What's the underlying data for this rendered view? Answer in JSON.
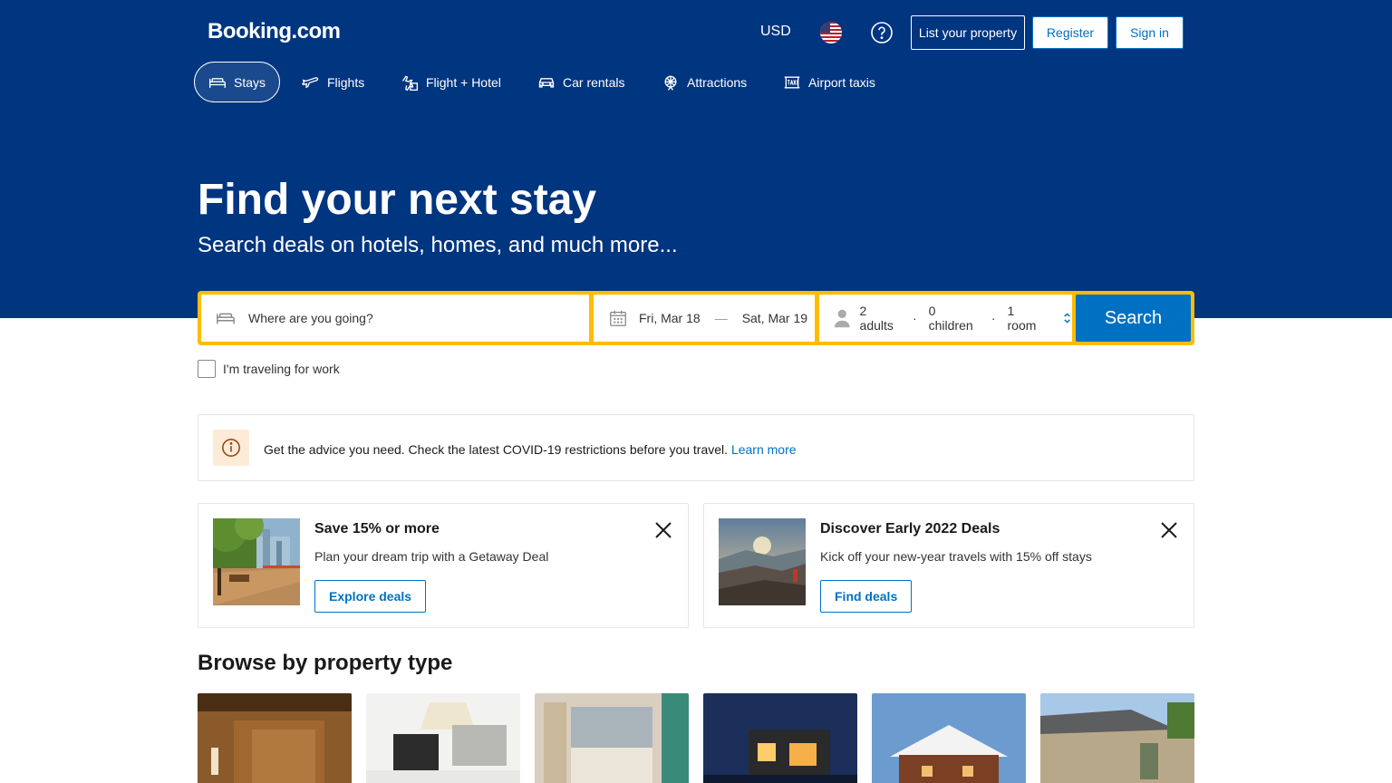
{
  "header": {
    "logo": "Booking.com",
    "currency": "USD",
    "flag_icon": "us-flag-icon",
    "help_icon": "question-circle-icon",
    "list_property": "List your property",
    "register": "Register",
    "sign_in": "Sign in"
  },
  "nav": {
    "items": [
      {
        "label": "Stays",
        "icon": "bed-icon",
        "active": true
      },
      {
        "label": "Flights",
        "icon": "plane-icon",
        "active": false
      },
      {
        "label": "Flight + Hotel",
        "icon": "plane-hotel-icon",
        "active": false
      },
      {
        "label": "Car rentals",
        "icon": "car-icon",
        "active": false
      },
      {
        "label": "Attractions",
        "icon": "ferris-wheel-icon",
        "active": false
      },
      {
        "label": "Airport taxis",
        "icon": "taxi-icon",
        "active": false
      }
    ]
  },
  "hero": {
    "title": "Find your next stay",
    "subtitle": "Search deals on hotels, homes, and much more..."
  },
  "search": {
    "destination_placeholder": "Where are you going?",
    "checkin": "Fri, Mar 18",
    "checkout": "Sat, Mar 19",
    "adults": "2 adults",
    "children": "0 children",
    "rooms": "1 room",
    "button": "Search"
  },
  "work_travel": {
    "label": "I'm traveling for work",
    "checked": false
  },
  "notice": {
    "text": "Get the advice you need. Check the latest COVID-19 restrictions before you travel.",
    "link": "Learn more"
  },
  "promos": [
    {
      "title": "Save 15% or more",
      "description": "Plan your dream trip with a Getaway Deal",
      "button": "Explore deals"
    },
    {
      "title": "Discover Early 2022 Deals",
      "description": "Kick off your new-year travels with 15% off stays",
      "button": "Find deals"
    }
  ],
  "browse": {
    "title": "Browse by property type"
  },
  "colors": {
    "brand_blue": "#003580",
    "action_blue": "#0071c2",
    "search_yellow": "#febb02"
  }
}
